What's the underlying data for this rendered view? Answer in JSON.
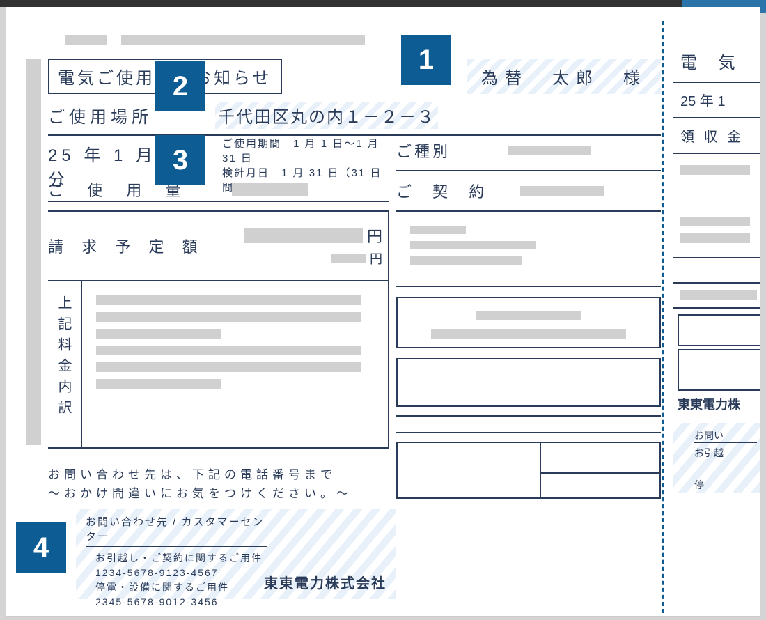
{
  "doc": {
    "title": "電気ご使用量のお知らせ",
    "customer": "為替　太郎　様",
    "location_label": "ご使用場所",
    "address": "千代田区丸の内１－２－３",
    "month": "25 年 1 月分",
    "period_label": "ご使用期間",
    "period_value": "1 月 1 日～1 月 31 日",
    "meter_label": "検針月日",
    "meter_value": "1 月 31 日（31 日間）",
    "usage_label": "ご 使 用 量",
    "billing_label": "請 求 予 定 額",
    "yen": "円",
    "breakdown_label": "上記料金内訳",
    "type_label": "ご種別",
    "contract_label": "ご 契 約"
  },
  "contact": {
    "line1": "お問い合わせ先は、下記の電話番号まで",
    "line2": "～おかけ間違いにお気をつけください。～",
    "box_title": "お問い合わせ先 / カスタマーセンター",
    "move_label": "お引越し・ご契約に関するご用件",
    "move_tel": "1234-5678-9123-4567",
    "outage_label": "停電・設備に関するご用件",
    "outage_tel": "2345-5678-9012-3456",
    "company": "東東電力株式会社"
  },
  "partial": {
    "title": "電 気",
    "row1": "25 年 1",
    "row2": "領 収 金",
    "company": "東東電力株",
    "contact1": "お問い",
    "contact2": "お引越",
    "contact3": "停"
  },
  "markers": {
    "m1": "1",
    "m2": "2",
    "m3": "3",
    "m4": "4"
  }
}
